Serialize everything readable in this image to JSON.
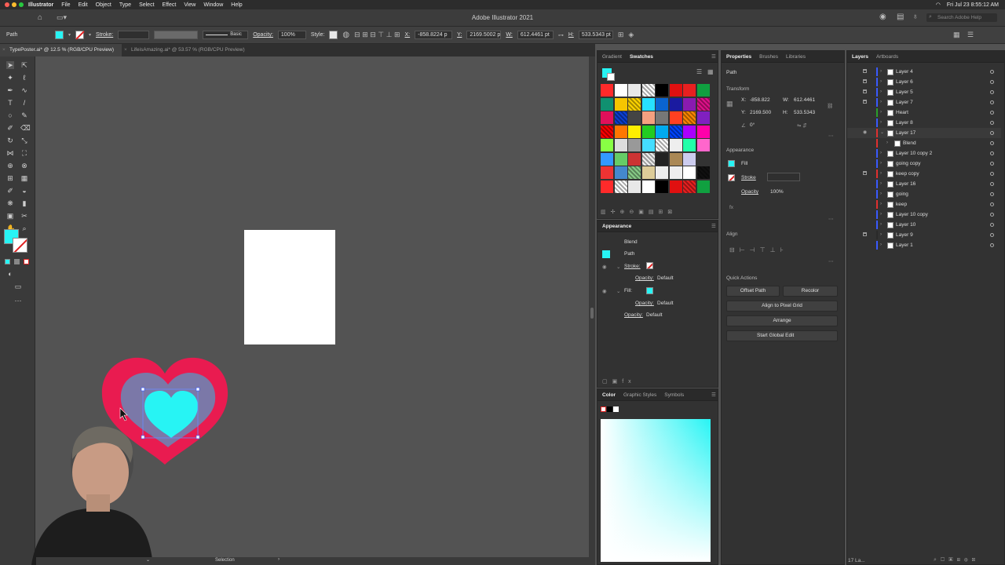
{
  "menubar": {
    "app": "Illustrator",
    "items": [
      "File",
      "Edit",
      "Object",
      "Type",
      "Select",
      "Effect",
      "View",
      "Window",
      "Help"
    ],
    "clock": "Fri Jul 23  8:55:12 AM"
  },
  "window": {
    "title": "Adobe Illustrator 2021",
    "search_placeholder": "Search Adobe Help"
  },
  "control": {
    "selection_type": "Path",
    "stroke_label": "Stroke:",
    "brush": "Basic",
    "opacity_label": "Opacity:",
    "opacity": "100%",
    "style_label": "Style:",
    "x_label": "X:",
    "x": "-858.8224 p",
    "y_label": "Y:",
    "y": "2169.5002 p",
    "w_label": "W:",
    "w": "612.4461 pt",
    "h_label": "H:",
    "h": "533.5343 pt",
    "fill_color": "#27f4f4"
  },
  "tabs": [
    {
      "label": "TypePoster.ai* @ 12.5 % (RGB/CPU Preview)",
      "active": true
    },
    {
      "label": "LifeisAmazing.ai* @ 53.57 % (RGB/CPU Preview)",
      "active": false
    }
  ],
  "swatches_panel": {
    "tabs": [
      "Gradient",
      "Swatches"
    ],
    "colors": [
      "#ffffff",
      "#e8e8e8",
      "#ffffff",
      "#000000",
      "#e0101c",
      "#e81a1a",
      "#1aa84a",
      "#0f9a3a",
      "#14a08a",
      "#f6c500",
      "#ffd400",
      "#27e0ff",
      "#0a64d0",
      "#1a1aa0",
      "#8a1ab0",
      "#e0108a",
      "#e0105a",
      "#0b3fd0",
      "#202020",
      "#f4a080",
      "#777777",
      "#ff4020",
      "#ff8800",
      "#8020c0"
    ]
  },
  "appearance_panel": {
    "title": "Appearance",
    "object": "Blend",
    "path": "Path",
    "stroke": "Stroke:",
    "opacity_label": "Opacity:",
    "opacity_value": "Default",
    "fill": "Fill:"
  },
  "color_panel": {
    "tabs": [
      "Color",
      "Graphic Styles",
      "Symbols"
    ],
    "fill": "#27f4f4"
  },
  "properties_panel": {
    "tabs": [
      "Properties",
      "Brushes",
      "Libraries"
    ],
    "kind": "Path",
    "transform": "Transform",
    "x_label": "X:",
    "x": "-858.822",
    "y_label": "Y:",
    "y": "2169.500",
    "w_label": "W:",
    "w": "612.4461",
    "h_label": "H:",
    "h": "533.5343",
    "rotate": "0°",
    "appearance": "Appearance",
    "fill": "Fill",
    "stroke": "Stroke",
    "opacity": "Opacity",
    "opacity_value": "100%",
    "align": "Align",
    "quick_actions": "Quick Actions",
    "buttons": [
      "Offset Path",
      "Recolor",
      "Align to Pixel Grid",
      "Arrange",
      "Start Global Edit"
    ]
  },
  "layers_panel": {
    "tabs": [
      "Layers",
      "Artboards"
    ],
    "count": "17 La...",
    "layers": [
      {
        "name": "Layer 4",
        "color": "#3a5aff",
        "lock": true
      },
      {
        "name": "Layer 6",
        "color": "#3a5aff",
        "lock": true
      },
      {
        "name": "Layer 5",
        "color": "#3a5aff",
        "lock": true
      },
      {
        "name": "Layer 7",
        "color": "#3a5aff",
        "lock": true
      },
      {
        "name": "Heart",
        "color": "#2aa02a",
        "lock": false
      },
      {
        "name": "Layer 8",
        "color": "#3a5aff",
        "lock": false
      },
      {
        "name": "Layer 17",
        "color": "#e03030",
        "lock": false,
        "eye": true,
        "open": true
      },
      {
        "name": "Blend",
        "color": "#e03030",
        "lock": false,
        "sub": true
      },
      {
        "name": "Layer 10 copy 2",
        "color": "#3a5aff",
        "lock": false
      },
      {
        "name": "going copy",
        "color": "#3a5aff",
        "lock": false
      },
      {
        "name": "keep copy",
        "color": "#e03030",
        "lock": true
      },
      {
        "name": "Layer 16",
        "color": "#3a5aff",
        "lock": false
      },
      {
        "name": "going",
        "color": "#3a5aff",
        "lock": false
      },
      {
        "name": "keep",
        "color": "#e03030",
        "lock": false
      },
      {
        "name": "Layer 10 copy",
        "color": "#3a5aff",
        "lock": false
      },
      {
        "name": "Layer 10",
        "color": "#3a5aff",
        "lock": false
      },
      {
        "name": "Layer 9",
        "color": "#2a2a2a",
        "lock": true
      },
      {
        "name": "Layer 1",
        "color": "#3a5aff",
        "lock": false
      }
    ]
  },
  "status": {
    "tool": "Selection"
  }
}
